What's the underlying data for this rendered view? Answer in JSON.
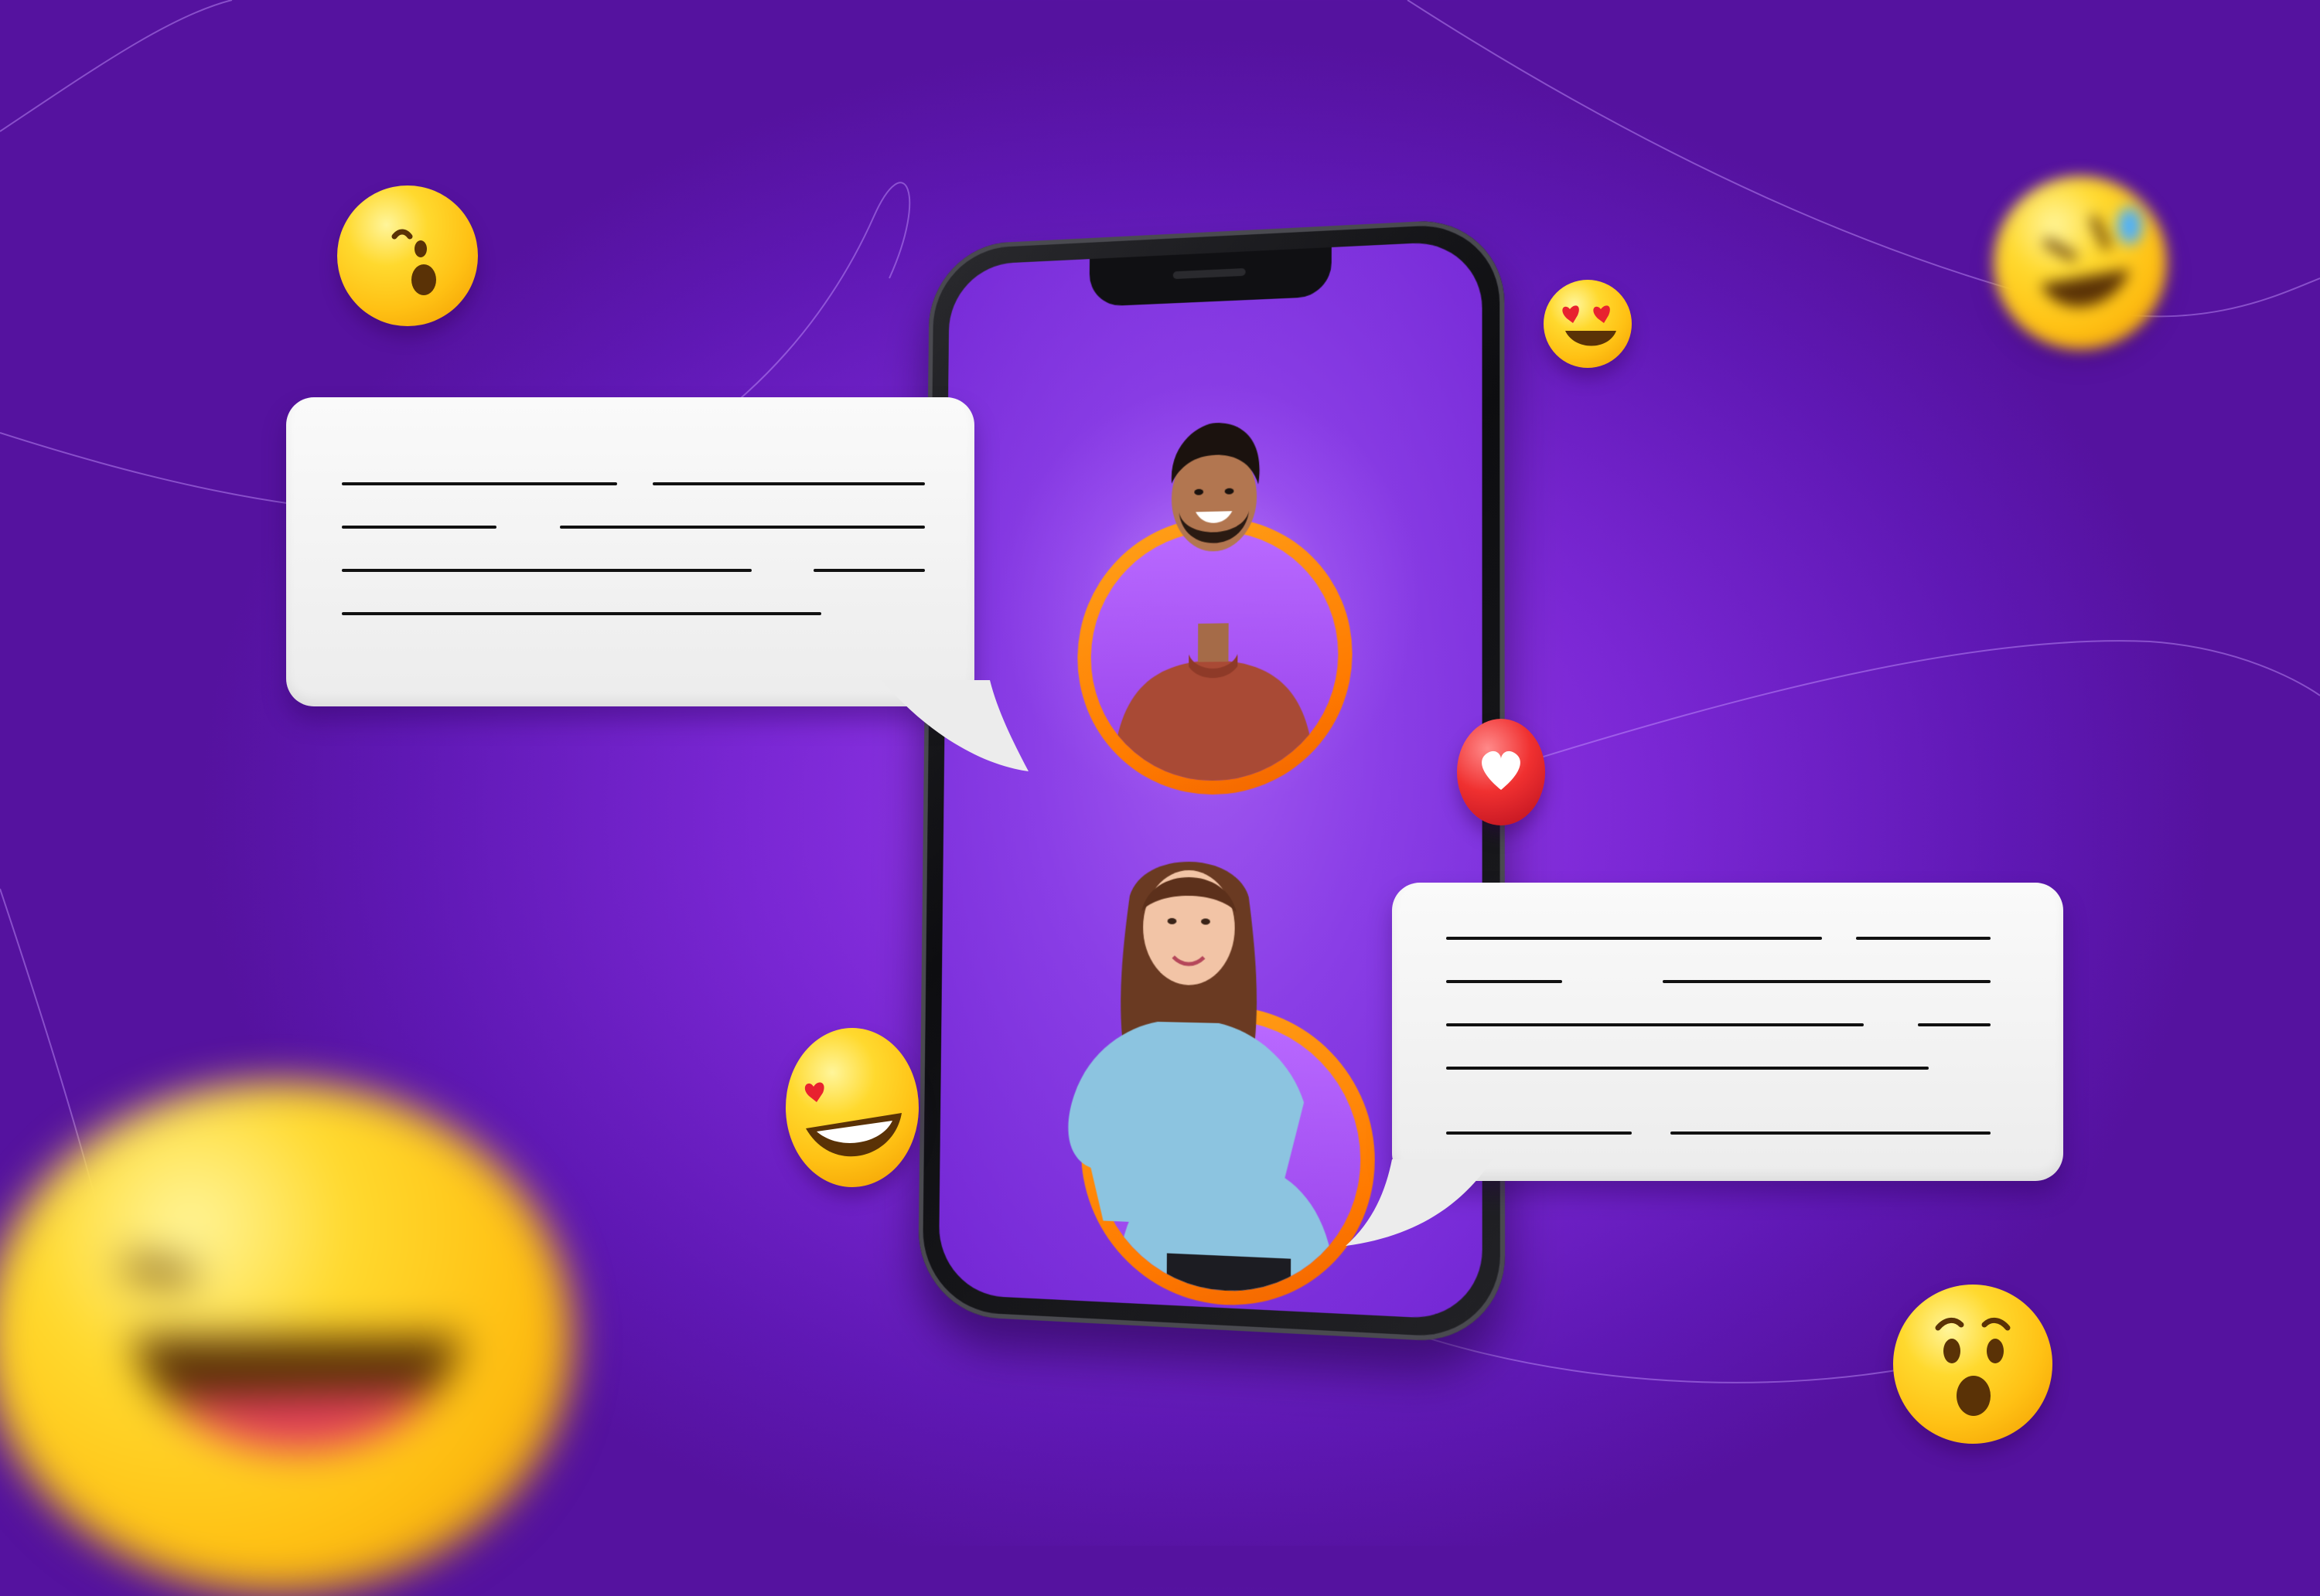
{
  "scene": {
    "description_tags": [
      "chat-app-illustration",
      "smartphone",
      "emoji",
      "speech-bubbles"
    ]
  },
  "colors": {
    "background_primary": "#7a27d4",
    "background_glow": "#9b3eee",
    "ring_orange": "#ff7a00",
    "bubble_white": "#f4f4f4",
    "emoji_yellow": "#ffc114",
    "heart_red": "#e8212f"
  },
  "icons": [
    "surprised-emoji",
    "heart-eyes-emoji",
    "rolling-laughing-emoji",
    "heart-reaction-icon",
    "laughing-emoji",
    "wow-emoji",
    "big-laugh-emoji"
  ]
}
